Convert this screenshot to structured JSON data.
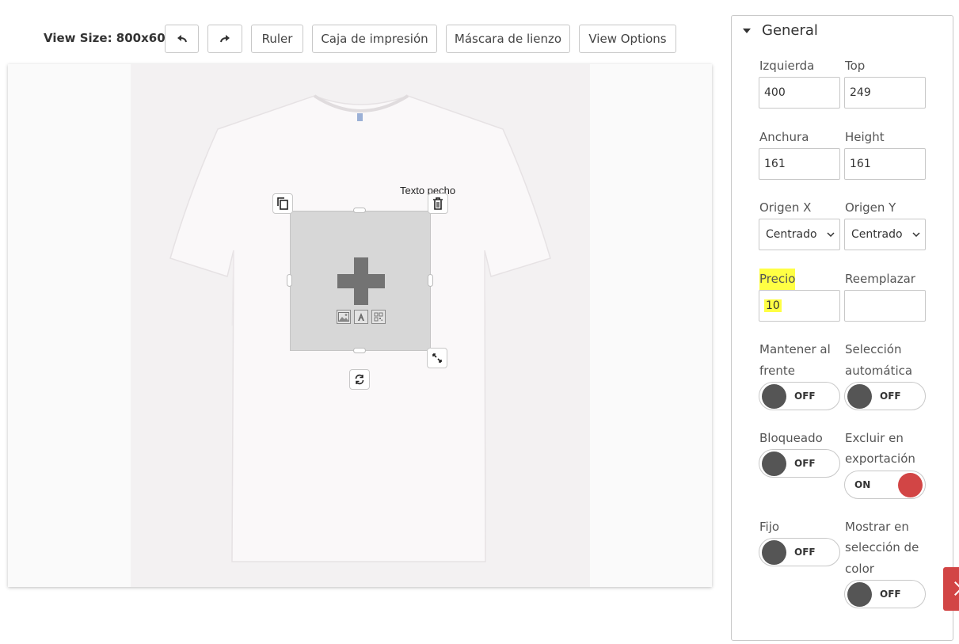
{
  "toolbar": {
    "view_size": "View Size: 800x600",
    "undo_icon": "undo-arrow-icon",
    "redo_icon": "redo-arrow-icon",
    "ruler": "Ruler",
    "print_box": "Caja de impresión",
    "canvas_mask": "Máscara de lienzo",
    "view_options": "View Options"
  },
  "canvas": {
    "chest_text": "Texto pecho",
    "placeholder_icons": [
      "image-icon",
      "text-icon",
      "qr-icon"
    ]
  },
  "panel": {
    "title": "General",
    "left_label": "Izquierda",
    "left_value": "400",
    "top_label": "Top",
    "top_value": "249",
    "width_label": "Anchura",
    "width_value": "161",
    "height_label": "Height",
    "height_value": "161",
    "origin_x_label": "Origen X",
    "origin_x_value": "Centrado",
    "origin_y_label": "Origen Y",
    "origin_y_value": "Centrado",
    "price_label": "Precio",
    "price_value": "10",
    "replace_label": "Reemplazar",
    "replace_value": "",
    "keep_front_label_1": "Mantener al",
    "keep_front_label_2": "frente",
    "keep_front_state": "OFF",
    "auto_select_label_1": "Selección",
    "auto_select_label_2": "automática",
    "auto_select_state": "OFF",
    "locked_label": "Bloqueado",
    "locked_state": "OFF",
    "exclude_label_1": "Excluir en",
    "exclude_label_2": "exportación",
    "exclude_state": "ON",
    "fixed_label": "Fijo",
    "fixed_state": "OFF",
    "show_color_label_1": "Mostrar en",
    "show_color_label_2": "selección de",
    "show_color_label_3": "color",
    "show_color_state": "OFF"
  },
  "colors": {
    "toggle_on": "#d24545",
    "toggle_off_knob": "#555555",
    "highlight": "#ffff44"
  }
}
